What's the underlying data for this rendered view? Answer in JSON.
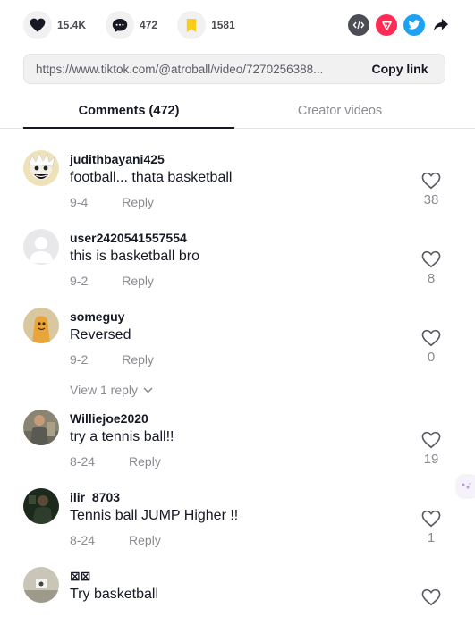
{
  "stats": {
    "likes": "15.4K",
    "comments": "472",
    "favorites": "1581"
  },
  "share_icons": [
    "embed-icon",
    "send-icon",
    "twitter-icon",
    "share-arrow-icon"
  ],
  "link": {
    "url": "https://www.tiktok.com/@atroball/video/7270256388...",
    "copy_label": "Copy link"
  },
  "tabs": {
    "comments": "Comments (472)",
    "creator": "Creator videos"
  },
  "comments": [
    {
      "username": "judithbayani425",
      "text": "football... thata basketball",
      "date": "9-4",
      "reply": "Reply",
      "likes": "38"
    },
    {
      "username": "user2420541557554",
      "text": "this is basketball bro",
      "date": "9-2",
      "reply": "Reply",
      "likes": "8"
    },
    {
      "username": "someguy",
      "text": "Reversed",
      "date": "9-2",
      "reply": "Reply",
      "likes": "0",
      "view_replies": "View 1 reply"
    },
    {
      "username": "Williejoe2020",
      "text": "try a tennis ball!!",
      "date": "8-24",
      "reply": "Reply",
      "likes": "19"
    },
    {
      "username": "ilir_8703",
      "text": "Tennis ball JUMP Higher !!",
      "date": "8-24",
      "reply": "Reply",
      "likes": "1"
    },
    {
      "username": "⊠⊠",
      "text": "Try basketball",
      "date": "",
      "reply": "",
      "likes": ""
    }
  ],
  "colors": {
    "like_red": "#161823",
    "favorite_yellow": "#FACE15",
    "embed_gray": "#4d4e55",
    "send_red": "#FE2C55",
    "twitter_blue": "#1DA1F2",
    "muted_text": "#8a8b91"
  }
}
